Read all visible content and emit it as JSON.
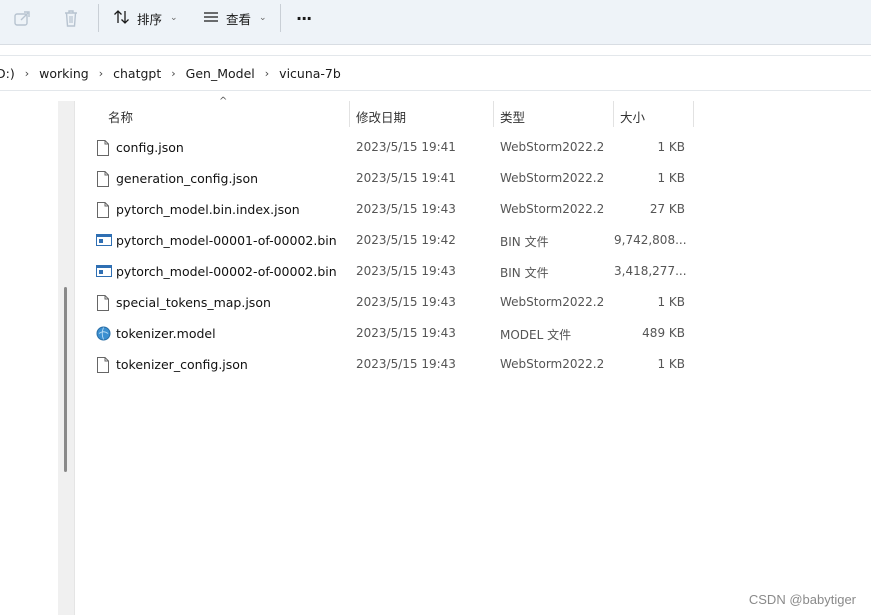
{
  "toolbar": {
    "sort_label": "排序",
    "view_label": "查看",
    "more_label": "···"
  },
  "address": {
    "crumbs": [
      "D:)",
      "working",
      "chatgpt",
      "Gen_Model",
      "vicuna-7b"
    ]
  },
  "columns": {
    "name": "名称",
    "date": "修改日期",
    "type": "类型",
    "size": "大小"
  },
  "files": [
    {
      "name": "config.json",
      "date": "2023/5/15 19:41",
      "type": "WebStorm2022.2",
      "size": "1 KB",
      "icon": "json-file-icon"
    },
    {
      "name": "generation_config.json",
      "date": "2023/5/15 19:41",
      "type": "WebStorm2022.2",
      "size": "1 KB",
      "icon": "json-file-icon"
    },
    {
      "name": "pytorch_model.bin.index.json",
      "date": "2023/5/15 19:43",
      "type": "WebStorm2022.2",
      "size": "27 KB",
      "icon": "json-file-icon"
    },
    {
      "name": "pytorch_model-00001-of-00002.bin",
      "date": "2023/5/15 19:42",
      "type": "BIN 文件",
      "size": "9,742,808...",
      "icon": "bin-file-icon"
    },
    {
      "name": "pytorch_model-00002-of-00002.bin",
      "date": "2023/5/15 19:43",
      "type": "BIN 文件",
      "size": "3,418,277...",
      "icon": "bin-file-icon"
    },
    {
      "name": "special_tokens_map.json",
      "date": "2023/5/15 19:43",
      "type": "WebStorm2022.2",
      "size": "1 KB",
      "icon": "json-file-icon"
    },
    {
      "name": "tokenizer.model",
      "date": "2023/5/15 19:43",
      "type": "MODEL 文件",
      "size": "489 KB",
      "icon": "model-file-icon"
    },
    {
      "name": "tokenizer_config.json",
      "date": "2023/5/15 19:43",
      "type": "WebStorm2022.2",
      "size": "1 KB",
      "icon": "json-file-icon"
    }
  ],
  "watermark": "CSDN @babytiger"
}
